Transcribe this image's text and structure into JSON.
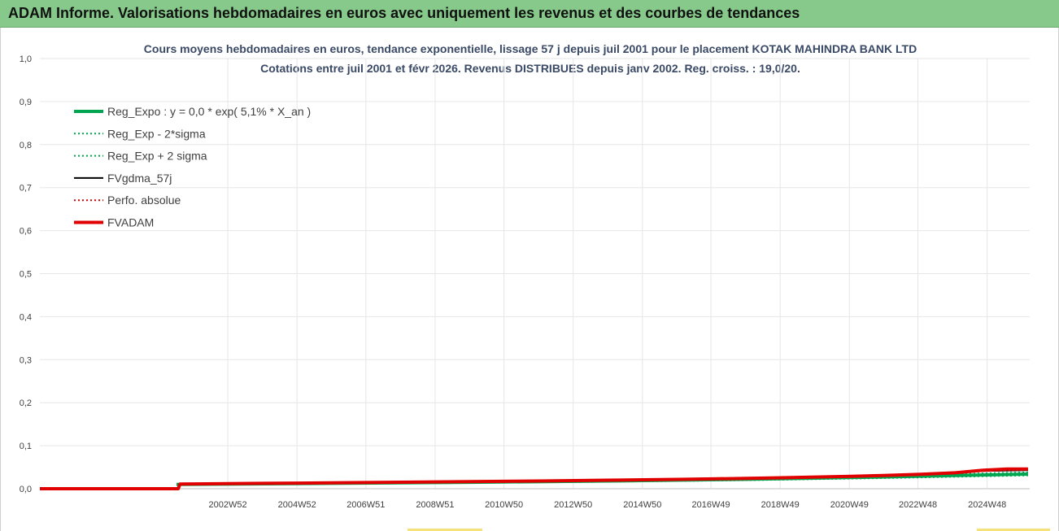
{
  "header": {
    "title": "ADAM Informe. Valorisations hebdomadaires en euros avec uniquement les revenus et des courbes de tendances"
  },
  "chart_data": {
    "type": "line",
    "title": "Cours moyens hebdomadaires en euros, tendance exponentielle, lissage 57 j depuis juil 2001 pour le placement KOTAK MAHINDRA BANK LTD",
    "subtitle": "Cotations entre juil 2001 et févr 2026. Revenus DISTRIBUES depuis janv 2002. Reg. croiss. : 19,0/20.",
    "xlabel": "",
    "ylabel": "",
    "ylim": [
      0,
      1.0
    ],
    "y_ticks": [
      "0,0",
      "0,1",
      "0,2",
      "0,3",
      "0,4",
      "0,5",
      "0,6",
      "0,7",
      "0,8",
      "0,9",
      "1,0"
    ],
    "x_ticks": [
      "2002W52",
      "2004W52",
      "2006W51",
      "2008W51",
      "2010W50",
      "2012W50",
      "2014W50",
      "2016W49",
      "2018W49",
      "2020W49",
      "2022W48",
      "2024W48"
    ],
    "x_tick_years": [
      2002.98,
      2004.98,
      2006.97,
      2008.97,
      2010.96,
      2012.96,
      2014.96,
      2016.94,
      2018.94,
      2020.94,
      2022.92,
      2024.92
    ],
    "x_range": [
      1997.55,
      2026.15
    ],
    "grid": true,
    "legend_position": "top-left",
    "series": [
      {
        "name": "Reg_Expo : y = 0,0 * exp( 5,1% *  X_an )",
        "color": "#00a550",
        "style": "solid",
        "width": 4,
        "x": [
          2001.5,
          2006,
          2010,
          2014,
          2018,
          2022,
          2026.1
        ],
        "y": [
          0.01,
          0.0125,
          0.015,
          0.018,
          0.022,
          0.0275,
          0.034
        ]
      },
      {
        "name": "Reg_Exp - 2*sigma",
        "color": "#00a550",
        "style": "dotted",
        "width": 2,
        "x": [
          2001.5,
          2006,
          2010,
          2014,
          2018,
          2022,
          2026.1
        ],
        "y": [
          0.009,
          0.0112,
          0.0135,
          0.0163,
          0.0199,
          0.0248,
          0.031
        ]
      },
      {
        "name": "Reg_Exp + 2 sigma",
        "color": "#00a550",
        "style": "dotted",
        "width": 2,
        "x": [
          2001.5,
          2006,
          2010,
          2014,
          2018,
          2022,
          2026.1
        ],
        "y": [
          0.011,
          0.0138,
          0.0167,
          0.02,
          0.0243,
          0.0302,
          0.038
        ]
      },
      {
        "name": "FVgdma_57j",
        "color": "#000000",
        "style": "solid",
        "width": 2,
        "x": [
          1997.55,
          2001.55,
          2001.6,
          2004,
          2008,
          2012,
          2016,
          2018,
          2020,
          2022,
          2024,
          2024.8,
          2026.1
        ],
        "y": [
          0.0,
          0.0,
          0.011,
          0.012,
          0.015,
          0.018,
          0.022,
          0.025,
          0.028,
          0.032,
          0.037,
          0.041,
          0.043
        ]
      },
      {
        "name": "Perfo. absolue",
        "color": "#d20000",
        "style": "dotted",
        "width": 2,
        "x": [
          1997.55,
          2001.55,
          2001.6,
          2004,
          2008,
          2012,
          2016,
          2018,
          2020,
          2022,
          2024,
          2024.8,
          2026.1
        ],
        "y": [
          0.0,
          0.0,
          0.011,
          0.012,
          0.015,
          0.018,
          0.022,
          0.025,
          0.028,
          0.032,
          0.037,
          0.041,
          0.044
        ]
      },
      {
        "name": "FVADAM",
        "color": "#e00000",
        "style": "solid",
        "width": 4,
        "x": [
          1997.55,
          2001.55,
          2001.6,
          2002,
          2003,
          2004,
          2005,
          2006,
          2007,
          2008,
          2009,
          2010,
          2011,
          2012,
          2013,
          2014,
          2015,
          2016,
          2017,
          2018,
          2019,
          2020,
          2021,
          2022,
          2023,
          2024,
          2024.8,
          2025.5,
          2026.1
        ],
        "y": [
          0.0,
          0.0,
          0.011,
          0.0112,
          0.0118,
          0.0124,
          0.013,
          0.0137,
          0.0144,
          0.0151,
          0.0158,
          0.0165,
          0.0172,
          0.018,
          0.0189,
          0.0198,
          0.0208,
          0.0218,
          0.0229,
          0.0242,
          0.0256,
          0.0272,
          0.029,
          0.031,
          0.0335,
          0.037,
          0.043,
          0.046,
          0.046
        ]
      }
    ]
  }
}
